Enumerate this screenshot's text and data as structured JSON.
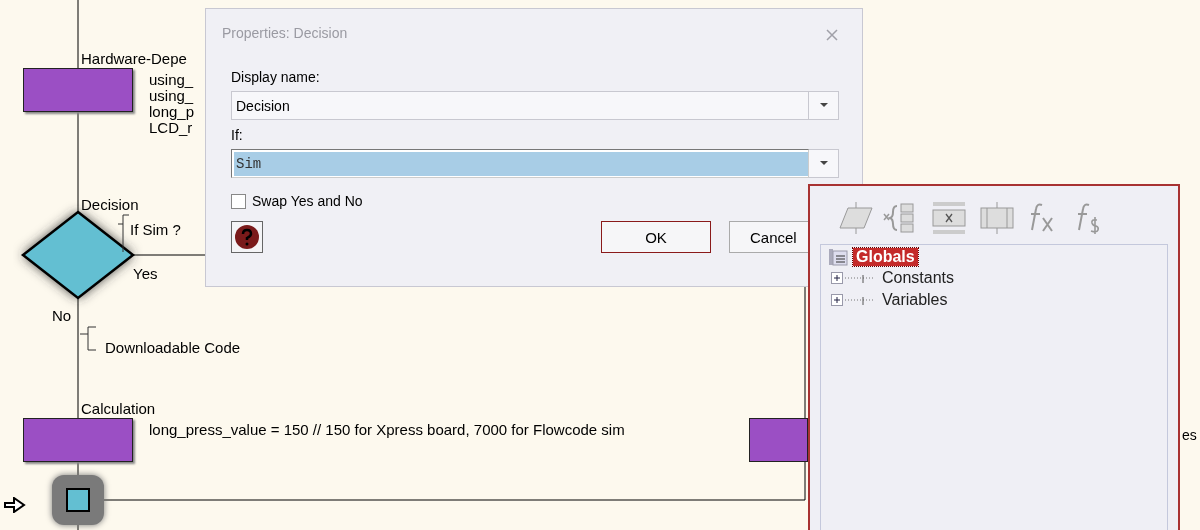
{
  "flowchart": {
    "nodes": [
      {
        "kind": "calculation",
        "label": "Hardware-Depe",
        "lines": [
          "using_",
          "using_",
          "long_p",
          "LCD_r"
        ]
      },
      {
        "kind": "decision",
        "label": "Decision",
        "condition": "If  Sim ?",
        "yes": "Yes",
        "no": "No"
      },
      {
        "kind": "comment",
        "text": "Downloadable Code"
      },
      {
        "kind": "calculation",
        "label": "Calculation",
        "lines": [
          "long_press_value = 150 // 150 for Xpress board, 7000 for Flowcode sim"
        ]
      }
    ],
    "right_edge_text": "es"
  },
  "dialog": {
    "title": "Properties: Decision",
    "display_name_label": "Display name:",
    "display_name": "Decision",
    "if_label": "If:",
    "if_value": "Sim",
    "if_selected": true,
    "swap": {
      "label": "Swap Yes and No",
      "checked": false
    },
    "buttons": [
      {
        "label": "OK",
        "kind": "default"
      },
      {
        "label": "Cancel",
        "kind": "normal"
      }
    ]
  },
  "panel": {
    "tree": [
      {
        "label": "Globals",
        "selected": true,
        "expanded": true,
        "children": [
          {
            "label": "Constants",
            "selected": false,
            "expanded": false
          },
          {
            "label": "Variables",
            "selected": false,
            "expanded": false
          }
        ]
      }
    ]
  }
}
